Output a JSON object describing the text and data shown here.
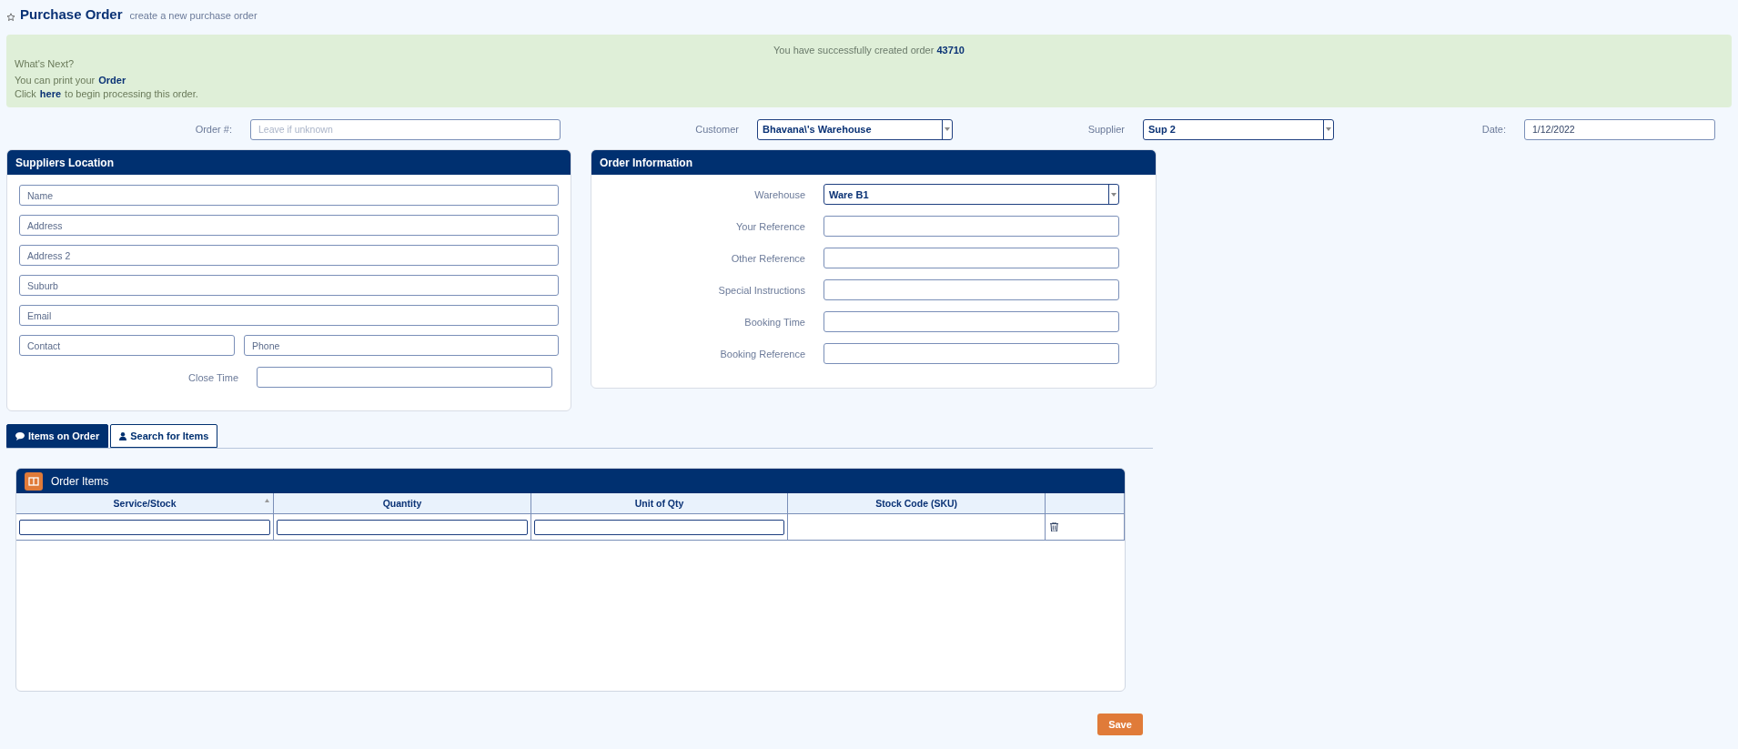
{
  "page": {
    "title": "Purchase Order",
    "subtitle": "create a new purchase order"
  },
  "alert": {
    "message": "You have successfully created order **43710**",
    "heading": "What's Next?",
    "lines": [
      {
        "before": "You can print your",
        "link": "Order"
      },
      {
        "before": "Click",
        "link": "here",
        "after": "to begin processing this order."
      }
    ]
  },
  "header_fields": [
    {
      "kind": "text",
      "label": "Order #:",
      "placeholder": "Leave if unknown"
    },
    {
      "kind": "select",
      "label": "Customer",
      "value": "Bhavana\\'s Warehouse"
    },
    {
      "kind": "select",
      "label": "Supplier",
      "value": "Sup 2"
    },
    {
      "kind": "text",
      "label": "Date:",
      "value": "1/12/2022"
    }
  ],
  "suppliers_location": {
    "title": "Suppliers Location",
    "fields": [
      {
        "placeholder": "Name"
      },
      {
        "placeholder": "Address"
      },
      {
        "placeholder": "Address 2"
      },
      {
        "placeholder": "Suburb"
      },
      {
        "placeholder": "Email"
      }
    ],
    "pair": [
      {
        "placeholder": "Contact"
      },
      {
        "placeholder": "Phone"
      }
    ],
    "close_time": {
      "label": "Close Time"
    }
  },
  "order_information": {
    "title": "Order Information",
    "fields": [
      {
        "kind": "select",
        "label": "Warehouse",
        "value": "Ware B1"
      },
      {
        "kind": "text",
        "label": "Your Reference"
      },
      {
        "kind": "text",
        "label": "Other Reference"
      },
      {
        "kind": "text",
        "label": "Special Instructions"
      },
      {
        "kind": "text",
        "label": "Booking Time"
      },
      {
        "kind": "text",
        "label": "Booking Reference"
      }
    ]
  },
  "tabs": [
    {
      "label": "Items on Order",
      "selected": true,
      "kind": "comment"
    },
    {
      "label": "Search for Items",
      "selected": false,
      "kind": "user"
    }
  ],
  "order_items": {
    "title": "Order Items",
    "columns": [
      {
        "label": "Service/Stock",
        "sorted": true
      },
      {
        "label": "Quantity",
        "sorted": false
      },
      {
        "label": "Unit of Qty",
        "sorted": false
      },
      {
        "label": "Stock Code (SKU)",
        "sorted": false
      },
      {
        "sorted": false
      }
    ],
    "rows": [
      {
        "cells": [
          {
            "kind": "input"
          },
          {
            "kind": "input"
          },
          {
            "kind": "input"
          },
          {
            "kind": "blank"
          },
          {
            "kind": "delete"
          }
        ]
      }
    ]
  },
  "save_button": "Save"
}
